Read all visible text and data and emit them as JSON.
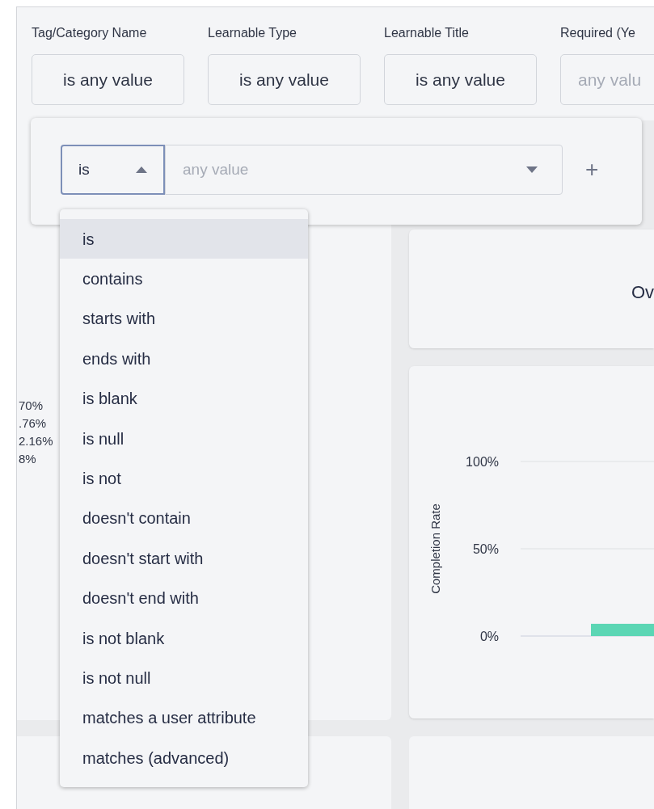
{
  "filters": [
    {
      "label": "Tag/Category Name",
      "value": "is any value",
      "placeholder": false
    },
    {
      "label": "Learnable Type",
      "value": "is any value",
      "placeholder": false
    },
    {
      "label": "Learnable Title",
      "value": "is any value",
      "placeholder": false
    },
    {
      "label": "Required (Ye",
      "value": "any valu",
      "placeholder": true
    }
  ],
  "editor": {
    "operator": "is",
    "expanded": true,
    "value_placeholder": "any value",
    "add": "+"
  },
  "operator_options": [
    {
      "label": "is",
      "selected": true
    },
    {
      "label": "contains",
      "selected": false
    },
    {
      "label": "starts with",
      "selected": false
    },
    {
      "label": "ends with",
      "selected": false
    },
    {
      "label": "is blank",
      "selected": false
    },
    {
      "label": "is null",
      "selected": false
    },
    {
      "label": "is not",
      "selected": false
    },
    {
      "label": "doesn't contain",
      "selected": false
    },
    {
      "label": "doesn't start with",
      "selected": false
    },
    {
      "label": "doesn't end with",
      "selected": false
    },
    {
      "label": "is not blank",
      "selected": false
    },
    {
      "label": "is not null",
      "selected": false
    },
    {
      "label": "matches a user attribute",
      "selected": false
    },
    {
      "label": "matches (advanced)",
      "selected": false
    }
  ],
  "left_tile": {
    "percentages": [
      "70%",
      ".76%",
      "2.16%",
      "8%"
    ]
  },
  "overview_tile": {
    "title": "Ov"
  },
  "completion_tile": {
    "chart_data": {
      "type": "bar",
      "ylabel": "Completion Rate",
      "ylim": [
        0,
        100
      ],
      "yticks": [
        {
          "value": 100,
          "label": "100%"
        },
        {
          "value": 50,
          "label": "50%"
        },
        {
          "value": 0,
          "label": "0%"
        }
      ],
      "series": [
        {
          "color": "#5bd6b4",
          "values": [
            7
          ]
        }
      ]
    }
  }
}
